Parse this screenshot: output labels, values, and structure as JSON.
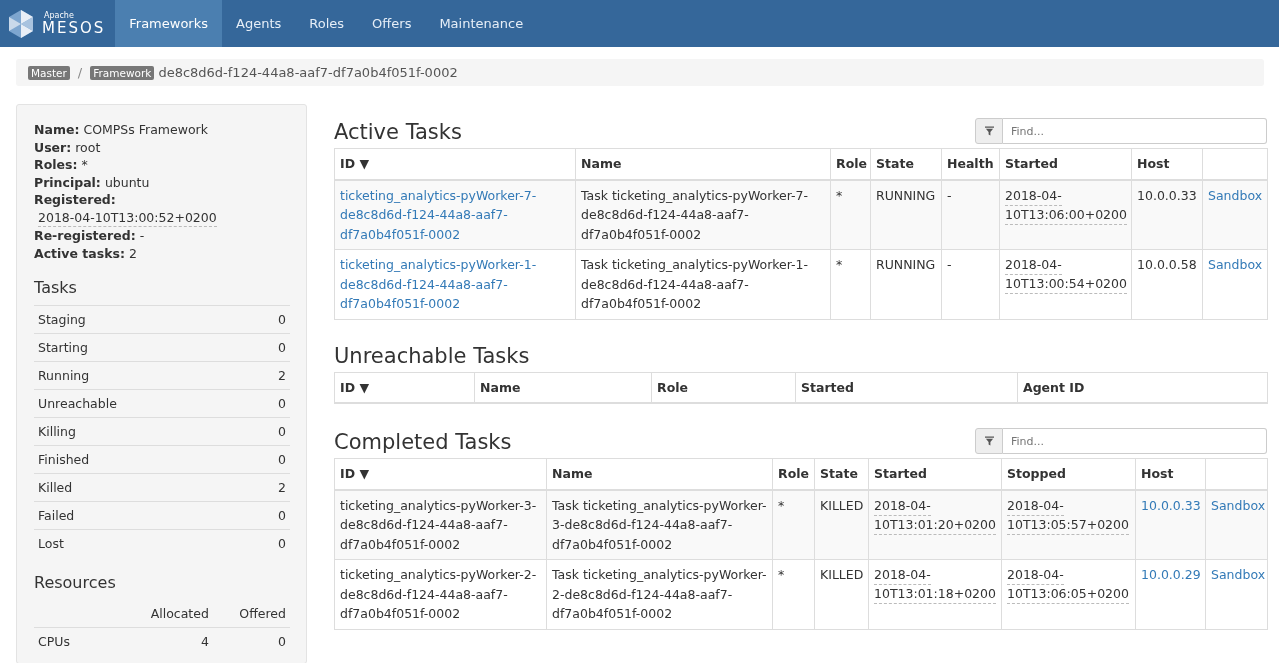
{
  "navbar": {
    "brand_small": "Apache",
    "brand": "MESOS",
    "items": [
      {
        "label": "Frameworks",
        "selected": true
      },
      {
        "label": "Agents",
        "selected": false
      },
      {
        "label": "Roles",
        "selected": false
      },
      {
        "label": "Offers",
        "selected": false
      },
      {
        "label": "Maintenance",
        "selected": false
      }
    ]
  },
  "breadcrumb": {
    "items": [
      "Master",
      "Framework"
    ],
    "separator": "/",
    "current": "de8c8d6d-f124-44a8-aaf7-df7a0b4f051f-0002"
  },
  "sidebar": {
    "info": [
      {
        "label": "Name:",
        "value": "COMPSs Framework",
        "kind": "text"
      },
      {
        "label": "User:",
        "value": "root",
        "kind": "text"
      },
      {
        "label": "Roles:",
        "value": "*",
        "kind": "text"
      },
      {
        "label": "Principal:",
        "value": "ubuntu",
        "kind": "text"
      },
      {
        "label": "Registered:",
        "value": "2018-04-10T13:00:52+0200",
        "kind": "date"
      },
      {
        "label": "Re-registered:",
        "value": "-",
        "kind": "text"
      },
      {
        "label": "Active tasks:",
        "value": "2",
        "kind": "text"
      }
    ],
    "tasks_title": "Tasks",
    "tasks": [
      {
        "label": "Staging",
        "count": "0"
      },
      {
        "label": "Starting",
        "count": "0"
      },
      {
        "label": "Running",
        "count": "2"
      },
      {
        "label": "Unreachable",
        "count": "0"
      },
      {
        "label": "Killing",
        "count": "0"
      },
      {
        "label": "Finished",
        "count": "0"
      },
      {
        "label": "Killed",
        "count": "2"
      },
      {
        "label": "Failed",
        "count": "0"
      },
      {
        "label": "Lost",
        "count": "0"
      }
    ],
    "resources_title": "Resources",
    "resources_columns": [
      "Allocated",
      "Offered"
    ],
    "resources": [
      {
        "label": "CPUs",
        "values": [
          "4",
          "0"
        ]
      }
    ]
  },
  "sections": [
    {
      "title": "Active Tasks",
      "search": {
        "placeholder": "Find..."
      },
      "columns": [
        {
          "label": "ID ▼"
        },
        {
          "label": "Name"
        },
        {
          "label": "Role"
        },
        {
          "label": "State"
        },
        {
          "label": "Health"
        },
        {
          "label": "Started"
        },
        {
          "label": "Host"
        },
        {}
      ],
      "rows": [
        [
          {
            "kind": "link",
            "text": "ticketing_analytics-pyWorker-7-de8c8d6d-f124-44a8-aaf7-df7a0b4f051f-0002"
          },
          {
            "kind": "text",
            "text": "Task ticketing_analytics-pyWorker-7-de8c8d6d-f124-44a8-aaf7-df7a0b4f051f-0002"
          },
          {
            "kind": "text",
            "text": "*"
          },
          {
            "kind": "text",
            "text": "RUNNING"
          },
          {
            "kind": "text",
            "text": "-"
          },
          {
            "kind": "date",
            "text": "2018-04-10T13:06:00+0200"
          },
          {
            "kind": "text",
            "text": "10.0.0.33"
          },
          {
            "kind": "link",
            "text": "Sandbox"
          }
        ],
        [
          {
            "kind": "link",
            "text": "ticketing_analytics-pyWorker-1-de8c8d6d-f124-44a8-aaf7-df7a0b4f051f-0002"
          },
          {
            "kind": "text",
            "text": "Task ticketing_analytics-pyWorker-1-de8c8d6d-f124-44a8-aaf7-df7a0b4f051f-0002"
          },
          {
            "kind": "text",
            "text": "*"
          },
          {
            "kind": "text",
            "text": "RUNNING"
          },
          {
            "kind": "text",
            "text": "-"
          },
          {
            "kind": "date",
            "text": "2018-04-10T13:00:54+0200"
          },
          {
            "kind": "text",
            "text": "10.0.0.58"
          },
          {
            "kind": "link",
            "text": "Sandbox"
          }
        ]
      ]
    },
    {
      "title": "Unreachable Tasks",
      "columns": [
        {
          "label": "ID ▼"
        },
        {
          "label": "Name"
        },
        {
          "label": "Role"
        },
        {
          "label": "Started"
        },
        {
          "label": "Agent ID"
        }
      ]
    },
    {
      "title": "Completed Tasks",
      "search": {
        "placeholder": "Find..."
      },
      "columns": [
        {
          "label": "ID ▼"
        },
        {
          "label": "Name"
        },
        {
          "label": "Role"
        },
        {
          "label": "State"
        },
        {
          "label": "Started"
        },
        {
          "label": "Stopped"
        },
        {
          "label": "Host"
        },
        {}
      ],
      "rows": [
        [
          {
            "kind": "text",
            "text": "ticketing_analytics-pyWorker-3-de8c8d6d-f124-44a8-aaf7-df7a0b4f051f-0002"
          },
          {
            "kind": "text",
            "text": "Task ticketing_analytics-pyWorker-3-de8c8d6d-f124-44a8-aaf7-df7a0b4f051f-0002"
          },
          {
            "kind": "text",
            "text": "*"
          },
          {
            "kind": "text",
            "text": "KILLED"
          },
          {
            "kind": "date",
            "text": "2018-04-10T13:01:20+0200"
          },
          {
            "kind": "date",
            "text": "2018-04-10T13:05:57+0200"
          },
          {
            "kind": "link",
            "text": "10.0.0.33"
          },
          {
            "kind": "link",
            "text": "Sandbox"
          }
        ],
        [
          {
            "kind": "text",
            "text": "ticketing_analytics-pyWorker-2-de8c8d6d-f124-44a8-aaf7-df7a0b4f051f-0002"
          },
          {
            "kind": "text",
            "text": "Task ticketing_analytics-pyWorker-2-de8c8d6d-f124-44a8-aaf7-df7a0b4f051f-0002"
          },
          {
            "kind": "text",
            "text": "*"
          },
          {
            "kind": "text",
            "text": "KILLED"
          },
          {
            "kind": "date",
            "text": "2018-04-10T13:01:18+0200"
          },
          {
            "kind": "date",
            "text": "2018-04-10T13:06:05+0200"
          },
          {
            "kind": "link",
            "text": "10.0.0.29"
          },
          {
            "kind": "link",
            "text": "Sandbox"
          }
        ]
      ]
    }
  ]
}
